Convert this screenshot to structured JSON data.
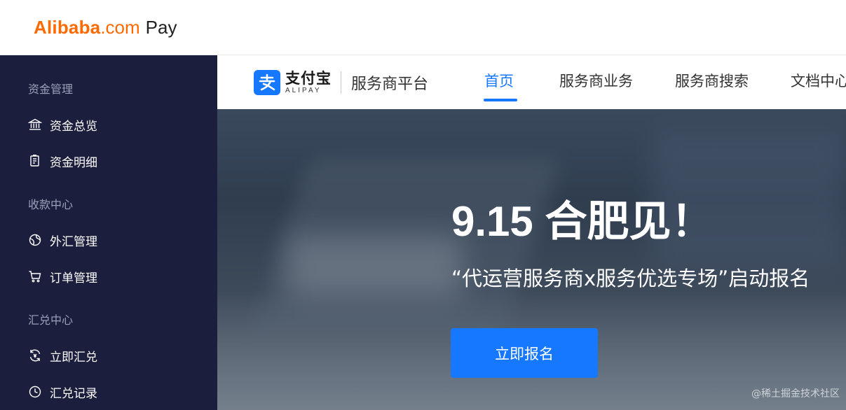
{
  "topbar": {
    "logo_main": "Alibaba",
    "logo_domain": ".com",
    "logo_pay": "Pay"
  },
  "sidebar": {
    "sections": [
      {
        "title": "资金管理",
        "items": [
          {
            "label": "资金总览",
            "icon": "bank-icon"
          },
          {
            "label": "资金明细",
            "icon": "document-list-icon"
          }
        ]
      },
      {
        "title": "收款中心",
        "items": [
          {
            "label": "外汇管理",
            "icon": "globe-icon"
          },
          {
            "label": "订单管理",
            "icon": "cart-icon"
          }
        ]
      },
      {
        "title": "汇兑中心",
        "items": [
          {
            "label": "立即汇兑",
            "icon": "exchange-icon"
          },
          {
            "label": "汇兑记录",
            "icon": "clock-icon"
          }
        ]
      }
    ]
  },
  "header": {
    "brand_cn": "支付宝",
    "brand_en": "ALIPAY",
    "platform": "服务商平台",
    "nav": [
      {
        "label": "首页",
        "active": true
      },
      {
        "label": "服务商业务",
        "active": false
      },
      {
        "label": "服务商搜索",
        "active": false
      },
      {
        "label": "文档中心",
        "active": false
      }
    ]
  },
  "banner": {
    "title": "9.15 合肥见！",
    "subtitle": "“代运营服务商x服务优选专场”启动报名",
    "cta_label": "立即报名",
    "watermark": "@稀土掘金技术社区"
  },
  "colors": {
    "brand_orange": "#ff6a00",
    "sidebar_bg": "#1b1f3d",
    "accent_blue": "#1677ff"
  }
}
